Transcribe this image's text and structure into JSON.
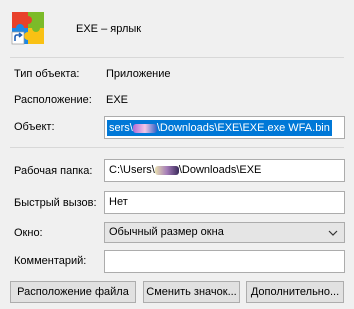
{
  "header": {
    "name": "EXE – ярлык",
    "icon": "app-puzzle-icon"
  },
  "info": {
    "type_label": "Тип объекта:",
    "type_value": "Приложение",
    "location_label": "Расположение:",
    "location_value": "EXE",
    "target_label": "Объект:",
    "target_value_prefix": "sers\\",
    "target_value_suffix": "\\Downloads\\EXE\\EXE.exe WFA.bin"
  },
  "props": {
    "workdir_label": "Рабочая папка:",
    "workdir_prefix": "C:\\Users\\",
    "workdir_suffix": "\\Downloads\\EXE",
    "hotkey_label": "Быстрый вызов:",
    "hotkey_value": "Нет",
    "window_label": "Окно:",
    "window_value": "Обычный размер окна",
    "comment_label": "Комментарий:",
    "comment_value": ""
  },
  "buttons": {
    "open_location": "Расположение файла",
    "change_icon": "Сменить значок...",
    "advanced": "Дополнительно..."
  },
  "colors": {
    "selection": "#0078d7",
    "background": "#f0f0f0"
  }
}
